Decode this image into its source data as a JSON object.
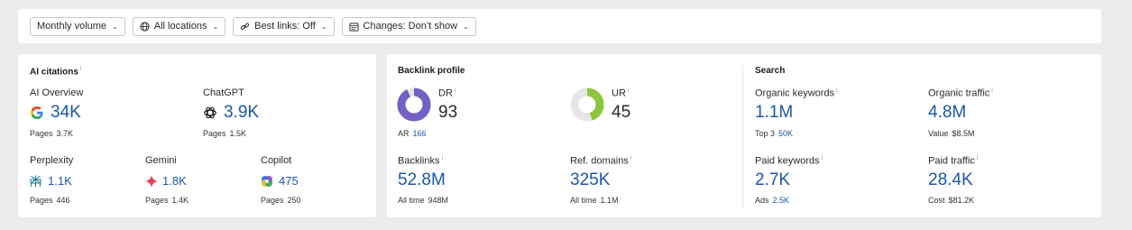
{
  "toolbar": {
    "monthly_volume": "Monthly volume",
    "all_locations": "All locations",
    "best_links": "Best links: Off",
    "changes": "Changes: Don’t show"
  },
  "ai_citations": {
    "title": "AI citations",
    "ai_overview": {
      "label": "AI Overview",
      "value": "34K",
      "sub_label": "Pages",
      "sub_value": "3.7K"
    },
    "chatgpt": {
      "label": "ChatGPT",
      "value": "3.9K",
      "sub_label": "Pages",
      "sub_value": "1.5K"
    },
    "perplexity": {
      "label": "Perplexity",
      "value": "1.1K",
      "sub_label": "Pages",
      "sub_value": "446"
    },
    "gemini": {
      "label": "Gemini",
      "value": "1.8K",
      "sub_label": "Pages",
      "sub_value": "1.4K"
    },
    "copilot": {
      "label": "Copilot",
      "value": "475",
      "sub_label": "Pages",
      "sub_value": "250"
    }
  },
  "backlink_profile": {
    "title": "Backlink profile",
    "dr": {
      "label": "DR",
      "value": "93",
      "fraction": 0.93,
      "color": "#7460c2"
    },
    "ar": {
      "label": "AR",
      "value": "166"
    },
    "ur": {
      "label": "UR",
      "value": "45",
      "fraction": 0.45,
      "color": "#8cc63e"
    },
    "backlinks": {
      "label": "Backlinks",
      "value": "52.8M",
      "sub_label": "All time",
      "sub_value": "948M"
    },
    "ref_domains": {
      "label": "Ref. domains",
      "value": "325K",
      "sub_label": "All time",
      "sub_value": "1.1M"
    }
  },
  "search": {
    "title": "Search",
    "organic_keywords": {
      "label": "Organic keywords",
      "value": "1.1M",
      "sub_label": "Top 3",
      "sub_value": "50K"
    },
    "organic_traffic": {
      "label": "Organic traffic",
      "value": "4.8M",
      "sub_label": "Value",
      "sub_value": "$8.5M"
    },
    "paid_keywords": {
      "label": "Paid keywords",
      "value": "2.7K",
      "sub_label": "Ads",
      "sub_value": "2.5K"
    },
    "paid_traffic": {
      "label": "Paid traffic",
      "value": "28.4K",
      "sub_label": "Cost",
      "sub_value": "$81.2K"
    }
  },
  "icons": {
    "info": "i",
    "chevron": "⌄"
  }
}
